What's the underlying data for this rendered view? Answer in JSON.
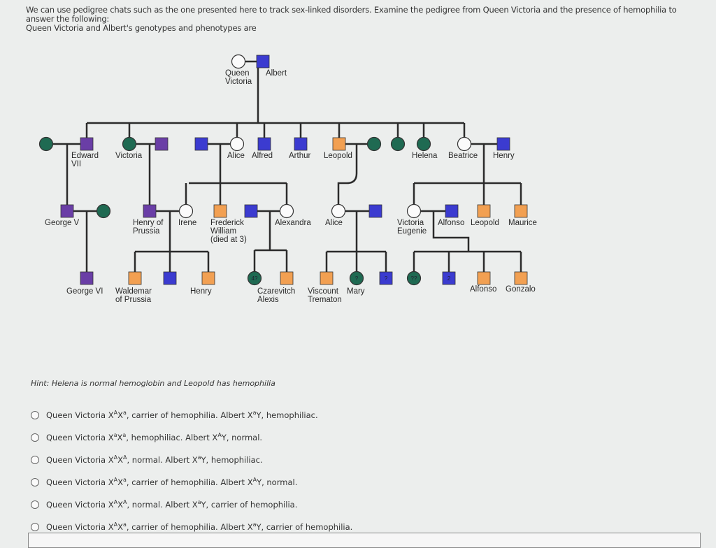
{
  "intro": {
    "line1": "We can use pedigree chats such as the one presented here to track sex-linked disorders. Examine the pedigree from Queen Victoria and the presence of hemophilia to answer the following:",
    "line2": "Queen Victoria and Albert's genotypes and phenotypes are"
  },
  "colors": {
    "purple": "#6a3ea6",
    "blue": "#3b3bd0",
    "orange": "#f2a052",
    "green": "#1f6a52",
    "white": "#fbfbfb",
    "line": "#2b2b2b"
  },
  "pedigree": {
    "people": [
      {
        "name": "Queen Victoria",
        "sex": "female",
        "fill": "white"
      },
      {
        "name": "Albert",
        "sex": "male",
        "fill": "blue"
      },
      {
        "name": "",
        "sex": "female",
        "fill": "green"
      },
      {
        "name": "Edward VII",
        "sex": "male",
        "fill": "purple"
      },
      {
        "name": "Victoria",
        "sex": "female",
        "fill": "green"
      },
      {
        "name": "",
        "sex": "male",
        "fill": "purple"
      },
      {
        "name": "",
        "sex": "male",
        "fill": "blue"
      },
      {
        "name": "Alice",
        "sex": "female",
        "fill": "white"
      },
      {
        "name": "Alfred",
        "sex": "male",
        "fill": "blue"
      },
      {
        "name": "Arthur",
        "sex": "male",
        "fill": "blue"
      },
      {
        "name": "Leopold",
        "sex": "male",
        "fill": "orange"
      },
      {
        "name": "",
        "sex": "female",
        "fill": "green"
      },
      {
        "name": "",
        "sex": "female",
        "fill": "green"
      },
      {
        "name": "Helena",
        "sex": "female",
        "fill": "green"
      },
      {
        "name": "Beatrice",
        "sex": "female",
        "fill": "white"
      },
      {
        "name": "Henry",
        "sex": "male",
        "fill": "blue"
      },
      {
        "name": "George V",
        "sex": "male",
        "fill": "purple"
      },
      {
        "name": "",
        "sex": "female",
        "fill": "green"
      },
      {
        "name": "Henry of Prussia",
        "sex": "male",
        "fill": "purple"
      },
      {
        "name": "Irene",
        "sex": "female",
        "fill": "white"
      },
      {
        "name": "Frederick William (died at 3)",
        "sex": "male",
        "fill": "orange"
      },
      {
        "name": "",
        "sex": "male",
        "fill": "blue"
      },
      {
        "name": "Alexandra",
        "sex": "female",
        "fill": "white"
      },
      {
        "name": "Alice",
        "sex": "female",
        "fill": "white"
      },
      {
        "name": "",
        "sex": "male",
        "fill": "blue"
      },
      {
        "name": "Victoria Eugenie",
        "sex": "female",
        "fill": "white"
      },
      {
        "name": "Alfonso",
        "sex": "male",
        "fill": "blue"
      },
      {
        "name": "Leopold",
        "sex": "male",
        "fill": "orange"
      },
      {
        "name": "Maurice",
        "sex": "male",
        "fill": "orange"
      },
      {
        "name": "George VI",
        "sex": "male",
        "fill": "purple"
      },
      {
        "name": "Waldemar of Prussia",
        "sex": "male",
        "fill": "orange"
      },
      {
        "name": "",
        "sex": "male",
        "fill": "blue"
      },
      {
        "name": "Henry",
        "sex": "male",
        "fill": "orange"
      },
      {
        "name": "",
        "sex": "female",
        "fill": "green",
        "mark": "4?"
      },
      {
        "name": "Czarevitch Alexis",
        "sex": "male",
        "fill": "orange"
      },
      {
        "name": "Viscount Trematon",
        "sex": "male",
        "fill": "orange"
      },
      {
        "name": "Mary",
        "sex": "female",
        "fill": "green",
        "mark": "?"
      },
      {
        "name": "",
        "sex": "male",
        "fill": "blue",
        "mark": "?"
      },
      {
        "name": "",
        "sex": "female",
        "fill": "green",
        "mark": "??"
      },
      {
        "name": "",
        "sex": "male",
        "fill": "blue",
        "mark": "2"
      },
      {
        "name": "Alfonso",
        "sex": "male",
        "fill": "orange"
      },
      {
        "name": "Gonzalo",
        "sex": "male",
        "fill": "orange"
      }
    ]
  },
  "hint": "Hint: Helena is normal hemoglobin and Leopold has hemophilia",
  "question": {
    "mother": "Queen Victoria",
    "father": "Albert",
    "options": [
      {
        "mother_alleles": [
          "A",
          "a"
        ],
        "mother_phenotype": "carrier of hemophilia.",
        "father_allele": "a",
        "father_phenotype": "hemophiliac."
      },
      {
        "mother_alleles": [
          "a",
          "a"
        ],
        "mother_phenotype": "hemophiliac.",
        "father_allele": "A",
        "father_phenotype": "normal."
      },
      {
        "mother_alleles": [
          "A",
          "A"
        ],
        "mother_phenotype": "normal.",
        "father_allele": "a",
        "father_phenotype": "hemophiliac."
      },
      {
        "mother_alleles": [
          "A",
          "a"
        ],
        "mother_phenotype": "carrier of hemophilia.",
        "father_allele": "A",
        "father_phenotype": "normal."
      },
      {
        "mother_alleles": [
          "A",
          "A"
        ],
        "mother_phenotype": "normal.",
        "father_allele": "a",
        "father_phenotype": "carrier of hemophilia."
      },
      {
        "mother_alleles": [
          "A",
          "a"
        ],
        "mother_phenotype": "carrier of hemophilia.",
        "father_allele": "a",
        "father_phenotype": "carrier of hemophilia."
      }
    ]
  }
}
